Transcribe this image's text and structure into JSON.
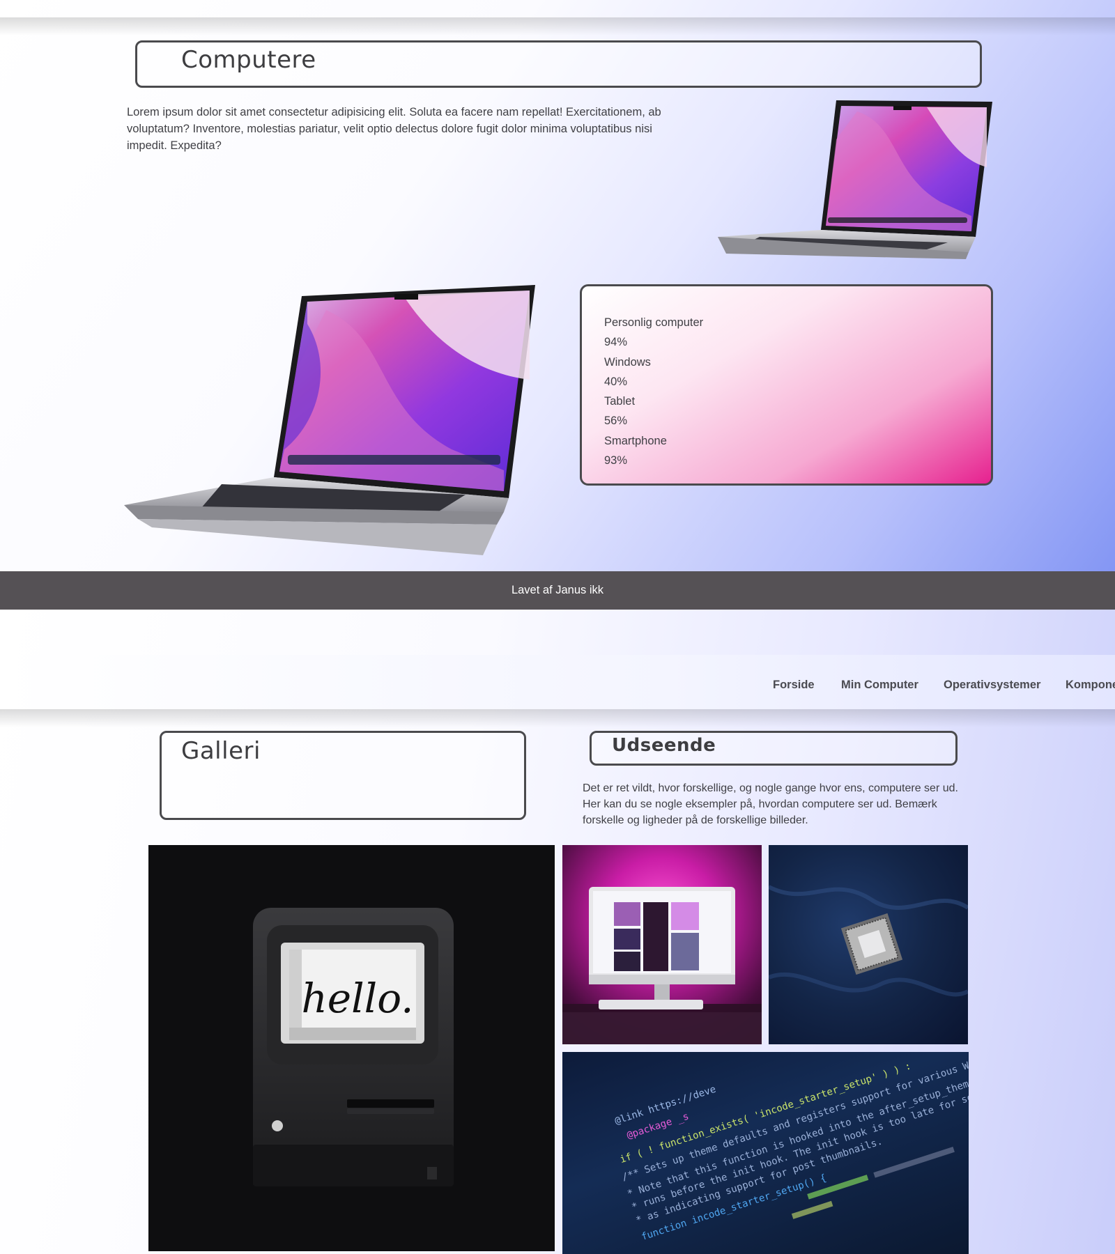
{
  "computere": {
    "title": "Computere",
    "paragraph": "Lorem ipsum dolor sit amet consectetur adipisicing elit. Soluta ea facere nam repellat! Exercitationem, ab voluptatum? Inventore, molestias pariatur, velit optio delectus dolore fugit dolor minima voluptatibus nisi impedit. Expedita?",
    "stats": [
      {
        "label": "Personlig computer",
        "value": "94%"
      },
      {
        "label": "Windows",
        "value": "40%"
      },
      {
        "label": "Tablet",
        "value": "56%"
      },
      {
        "label": "Smartphone",
        "value": "93%"
      }
    ]
  },
  "footer": {
    "text": "Lavet af Janus ikk"
  },
  "nav": {
    "items": [
      "Forside",
      "Min Computer",
      "Operativsystemer",
      "Kompone"
    ]
  },
  "galleri": {
    "title": "Galleri"
  },
  "udseende": {
    "title": "Udseende",
    "paragraph": "Det er ret vildt, hvor forskellige, og nogle gange hvor ens, computere ser ud. Her kan du se nogle eksempler på, hvordan computere ser ud. Bemærk forskelle og ligheder på de forskellige billeder."
  },
  "gallery_images": {
    "mac_screen_text": "hello.",
    "code_lines": [
      "@link https://deve",
      "@package _s",
      "if ( ! function_exists( 'incode_starter_setup' ) ) :",
      "/** Sets up theme defaults and registers support for various WordPress",
      "* Note that this function is hooked into the after_setup_theme hook",
      "* runs before the init hook. The init hook is too late for some features",
      "* as indicating support for post thumbnails.",
      "function incode_starter_setup() {"
    ]
  },
  "colors": {
    "accent_pink": "#e6218f",
    "footer_bg": "#555155",
    "border": "#4a4a4d",
    "gradient_blue": "#7f92f3"
  }
}
